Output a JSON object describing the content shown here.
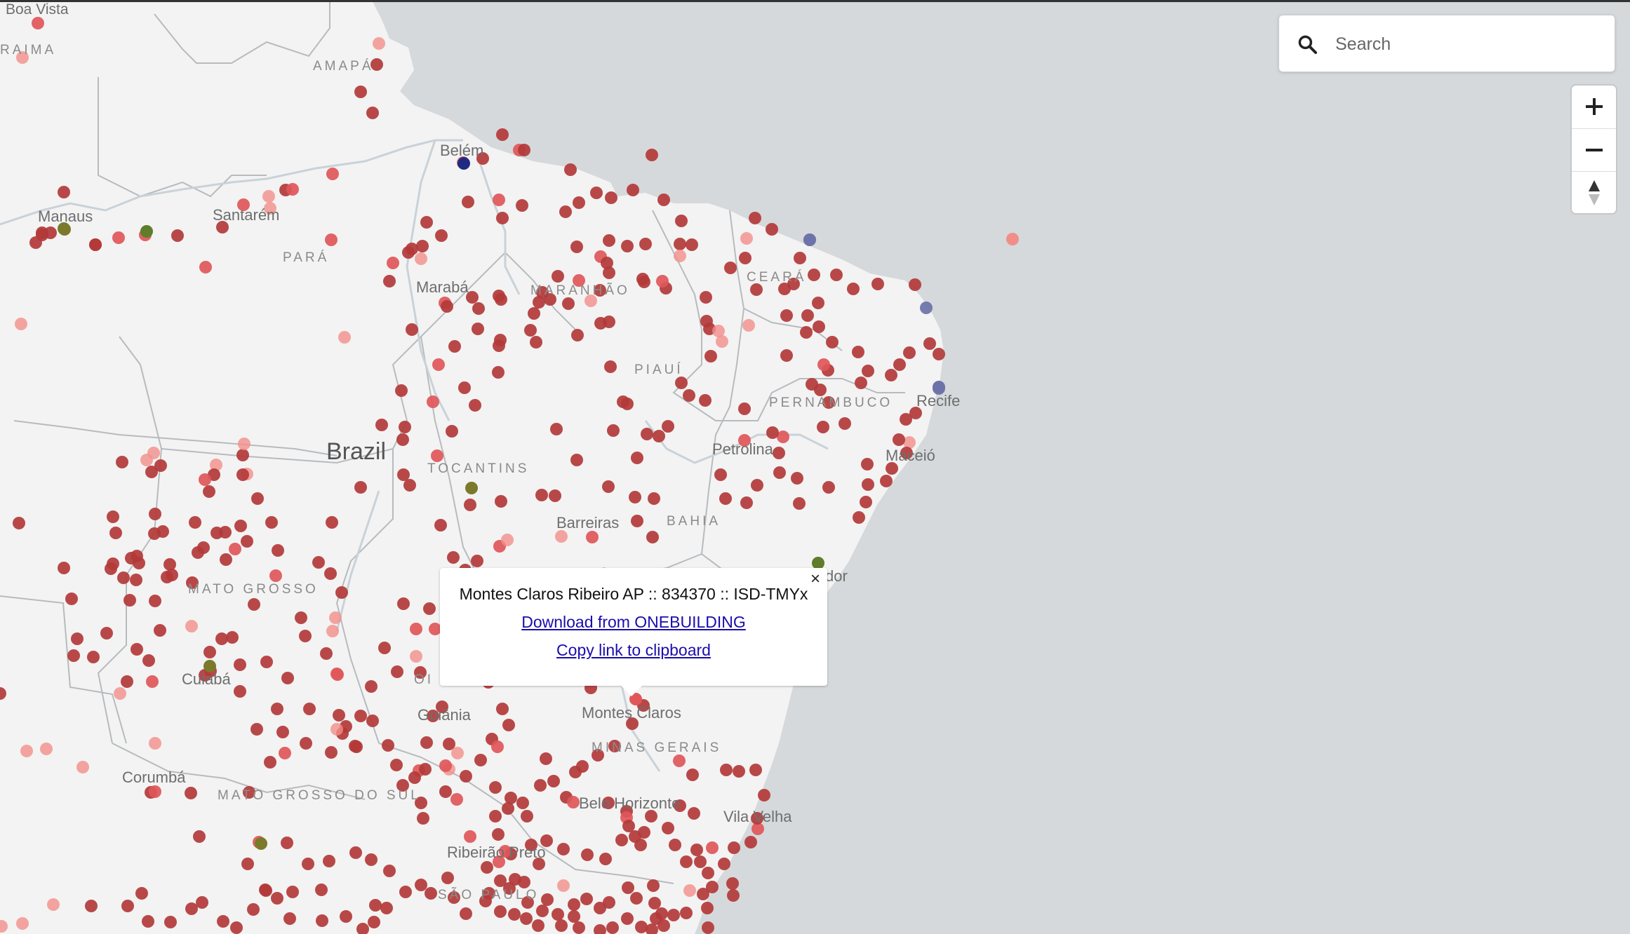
{
  "map": {
    "colors": {
      "ocean": "#d5d9db",
      "land": "#f3f3f3",
      "border": "#a9adb0",
      "river": "#c6d0d6",
      "label": "#6e6e6e",
      "state_label": "#8a8a8a",
      "marker_dark": "#b33a3a",
      "marker_medium": "#e0575a",
      "marker_light": "#f28e89",
      "marker_blue": "#1f2b82",
      "marker_green": "#5f7d2a",
      "marker_olive": "#7a7a2a",
      "marker_gray_blue": "#6d72a8"
    },
    "country_label": "Brazil",
    "city_labels": [
      "Boa Vista",
      "Manaus",
      "Santarém",
      "Belém",
      "Marabá",
      "Recife",
      "Petrolina",
      "Maceió",
      "Barreiras",
      "dor",
      "Cuiabá",
      "Goiânia",
      "Montes Claros",
      "Corumbá",
      "Belo Horizonte",
      "Vila Velha",
      "Ribeirão Preto"
    ],
    "state_labels": [
      "RAIMA",
      "AMAPÁ",
      "PARÁ",
      "MARANHÃO",
      "CEARÁ",
      "PIAUÍ",
      "PERNAMBUCO",
      "TOCANTINS",
      "BAHIA",
      "MATO GROSSO",
      "MINAS GERAIS",
      "MATO GROSSO DO SUL",
      "SÃO PAULO",
      "OI"
    ]
  },
  "search": {
    "icon": "search-icon",
    "placeholder": "Search"
  },
  "navigation": {
    "zoom_in": "zoom-in-icon",
    "zoom_out": "zoom-out-icon",
    "compass": "compass-icon"
  },
  "popup": {
    "close_label": "×",
    "title": "Montes Claros Ribeiro AP :: 834370 :: ISD-TMYx",
    "download_link": "Download from ONEBUILDING",
    "copy_link": "Copy link to clipboard"
  }
}
